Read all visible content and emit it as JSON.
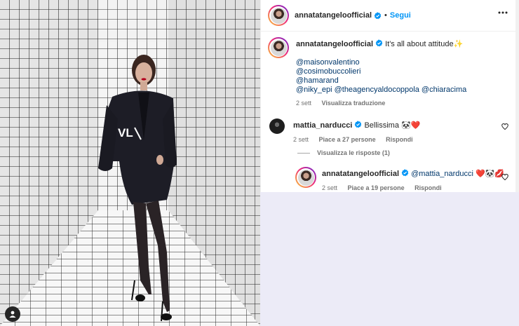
{
  "post": {
    "author": "annatatangeloofficial",
    "dot": "•",
    "follow_label": "Segui",
    "caption_text": "It's all about attitude✨",
    "mentions": [
      "@maisonvalentino",
      "@cosimobuccolieri",
      "@hamarand"
    ],
    "mention_line": [
      "@niky_epi",
      "@theagencyaldocoppola",
      "@chiaracima"
    ],
    "caption_time": "2 sett",
    "translate_label": "Visualizza traduzione"
  },
  "comments": [
    {
      "author": "mattia_narducci",
      "text": "Bellissima 🐼❤️",
      "time": "2 sett",
      "likes": "Piace a 27 persone",
      "reply_label": "Rispondi",
      "view_replies": "Visualizza le risposte (1)"
    },
    {
      "author": "annatatangeloofficial",
      "mention": "@mattia_narducci",
      "text": "❤️🐼💋",
      "time": "2 sett",
      "likes": "Piace a 19 persone",
      "reply_label": "Rispondi"
    }
  ],
  "icons": {
    "verified": "verified-badge-icon",
    "more": "more-options-icon",
    "like": "heart-icon",
    "user_tag": "user-tag-icon"
  },
  "colors": {
    "link_blue": "#0095f6",
    "mention_blue": "#00376b",
    "meta_gray": "#737373",
    "lower_background": "#ecebf7"
  }
}
